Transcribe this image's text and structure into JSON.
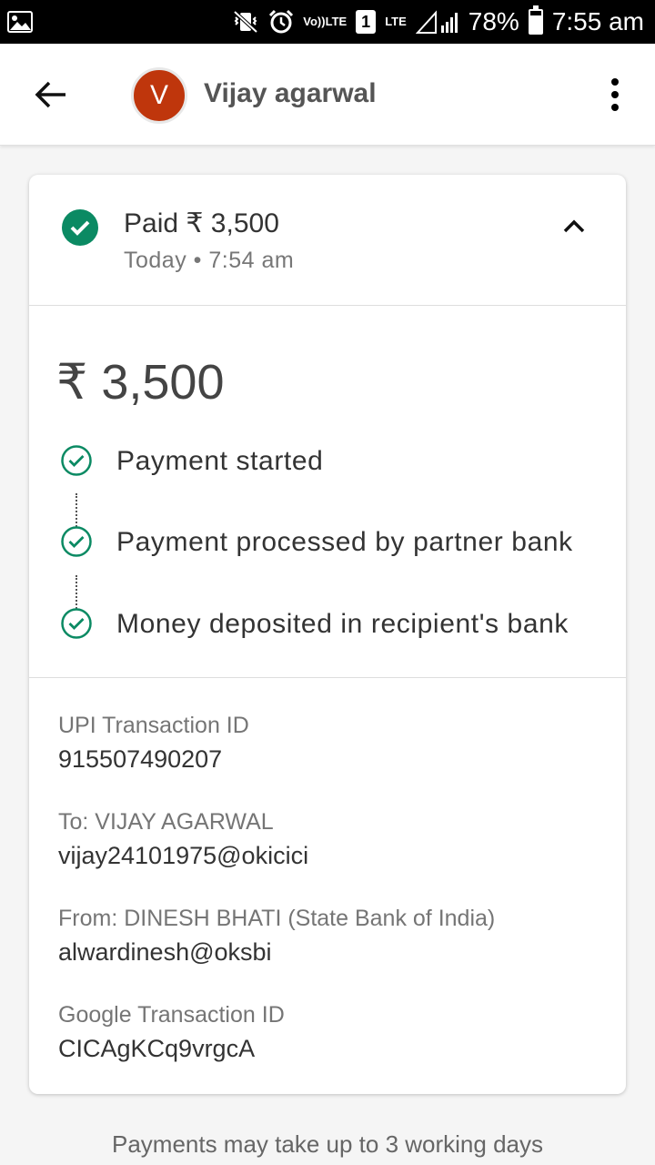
{
  "status_bar": {
    "volte_label": "Vo))",
    "lte_label": "LTE",
    "sim_number": "1",
    "battery_percent": "78%",
    "battery_level": 0.78,
    "time": "7:55 am"
  },
  "app_bar": {
    "avatar_initial": "V",
    "avatar_color": "#bf360c",
    "contact_name": "Vijay agarwal"
  },
  "summary": {
    "title": "Paid ₹ 3,500",
    "subtitle": "Today • 7:54 am",
    "status_color": "#0b8a63"
  },
  "amount": "₹ 3,500",
  "steps": [
    {
      "label": "Payment started",
      "icon": "check-circle-outline-icon"
    },
    {
      "label": "Payment processed by partner bank",
      "icon": "check-circle-outline-icon"
    },
    {
      "label": "Money deposited in recipient's bank",
      "icon": "check-circle-outline-icon"
    }
  ],
  "details": {
    "upi_label": "UPI Transaction ID",
    "upi_value": "915507490207",
    "to_label": "To: VIJAY AGARWAL",
    "to_value": "vijay24101975@okicici",
    "from_label": "From: DINESH  BHATI (State Bank of India)",
    "from_value": "alwardinesh@oksbi",
    "google_label": "Google Transaction ID",
    "google_value": "CICAgKCq9vrgcA"
  },
  "footer_note": "Payments may take up to 3 working days"
}
